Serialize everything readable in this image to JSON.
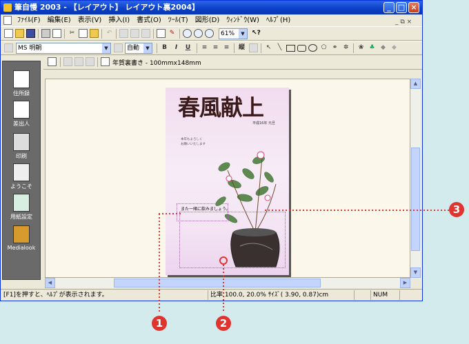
{
  "window": {
    "title": "筆自慢 2003 - 【レイアウト】 レイアウト裏2004】",
    "controls": {
      "minimize": "_",
      "maximize": "□",
      "close": "×"
    }
  },
  "menubar": {
    "items": [
      "ﾌｧｲﾙ(F)",
      "編集(E)",
      "表示(V)",
      "挿入(I)",
      "書式(O)",
      "ﾂｰﾙ(T)",
      "図形(D)",
      "ｳｨﾝﾄﾞｳ(W)",
      "ﾍﾙﾌﾟ(H)"
    ],
    "mdi_controls": "_ ⧉ ×"
  },
  "toolbar1": {
    "zoom_value": "61%"
  },
  "toolbar2": {
    "font_name": "MS 明朝",
    "font_size": "自動",
    "bold": "B",
    "italic": "I",
    "underline": "U",
    "vertical": "縦"
  },
  "toolbar3": {
    "page_label": "年賀裏書き - 100mmx148mm"
  },
  "left_panel": {
    "items": [
      {
        "label": "住所録",
        "icon": "address-book-icon"
      },
      {
        "label": "差出人",
        "icon": "sender-icon"
      },
      {
        "label": "印刷",
        "icon": "printer-icon"
      },
      {
        "label": "ようこそ",
        "icon": "welcome-icon"
      },
      {
        "label": "用紙設定",
        "icon": "paper-setup-icon"
      },
      {
        "label": "Medialook",
        "icon": "medialook-icon"
      }
    ]
  },
  "card": {
    "title": "春風献上",
    "date": "平成16年 元旦",
    "message_line1": "本年もよろしく",
    "message_line2": "お願いいたします",
    "text_line": "また一緒に飲みましょう。"
  },
  "statusbar": {
    "help_text": "[F1]を押すと、ﾍﾙﾌﾟが表示されます。",
    "info": "比率 100.0, 20.0% ｻｲｽﾞ( 3.90, 0.87)cm",
    "num": "NUM"
  },
  "callouts": [
    "1",
    "2",
    "3"
  ],
  "colors": {
    "accent": "#e0342f",
    "title_bar": "#0b3fc6",
    "card_bg": "#f1dcef"
  }
}
